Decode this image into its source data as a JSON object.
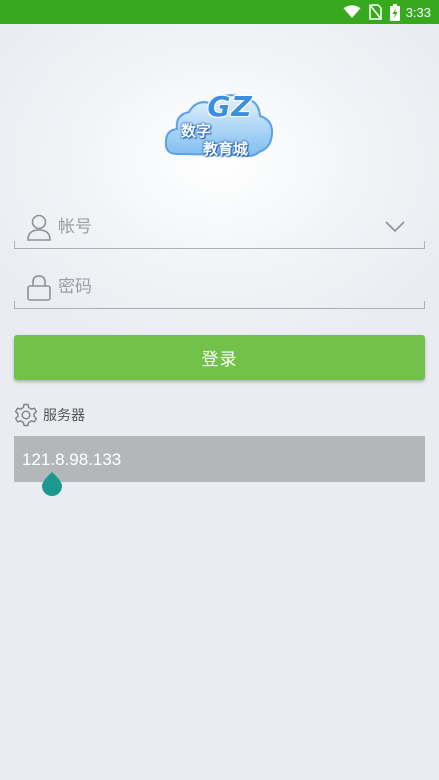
{
  "status_bar": {
    "time": "3:33",
    "icons": [
      "wifi-icon",
      "no-sim-icon",
      "battery-charging-icon"
    ]
  },
  "logo": {
    "mark": "GZ",
    "line1": "数字",
    "line2": "教育城"
  },
  "form": {
    "account": {
      "placeholder": "帐号",
      "value": "",
      "icon": "user-icon",
      "dropdown_icon": "chevron-down-icon"
    },
    "password": {
      "placeholder": "密码",
      "value": "",
      "icon": "lock-icon"
    },
    "login_label": "登录"
  },
  "server": {
    "label": "服务器",
    "icon": "gear-icon",
    "value": "121.8.98.133"
  },
  "colors": {
    "status_bar": "#36a91c",
    "login_button": "#72c24a",
    "server_box": "#b4b7b9",
    "cursor_handle": "#1a9a8e"
  }
}
